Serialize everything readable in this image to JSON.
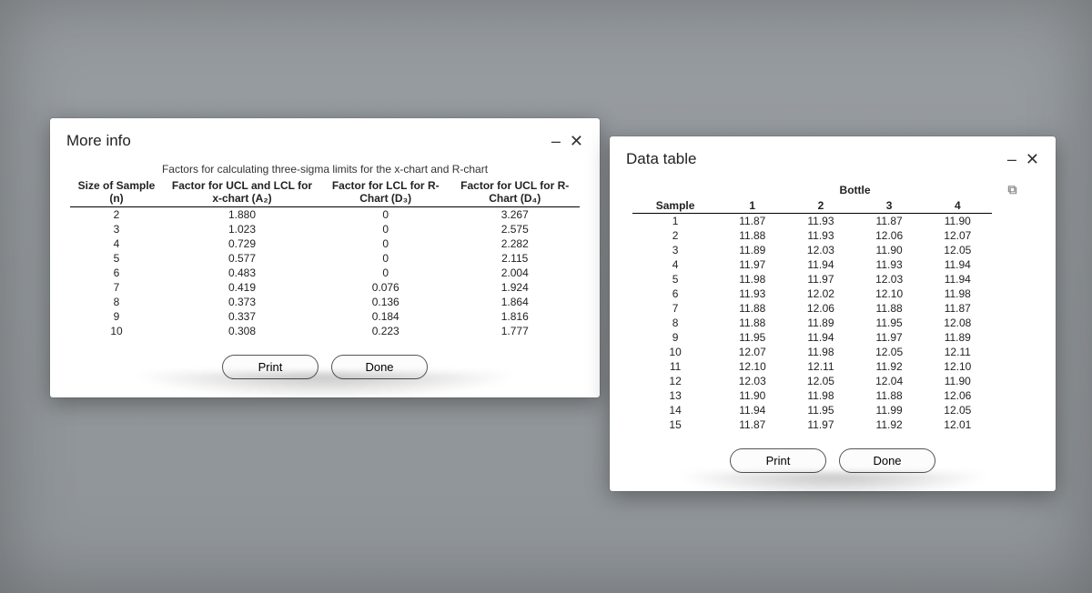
{
  "modal1": {
    "title": "More info",
    "caption": "Factors for calculating three-sigma limits for the x-chart and R-chart",
    "headers": {
      "n": "Size of Sample (n)",
      "a2": "Factor for UCL and LCL for x-chart (A₂)",
      "d3": "Factor for LCL for R-Chart (D₃)",
      "d4": "Factor for UCL for R-Chart (D₄)"
    },
    "rows": [
      {
        "n": "2",
        "a2": "1.880",
        "d3": "0",
        "d4": "3.267"
      },
      {
        "n": "3",
        "a2": "1.023",
        "d3": "0",
        "d4": "2.575"
      },
      {
        "n": "4",
        "a2": "0.729",
        "d3": "0",
        "d4": "2.282"
      },
      {
        "n": "5",
        "a2": "0.577",
        "d3": "0",
        "d4": "2.115"
      },
      {
        "n": "6",
        "a2": "0.483",
        "d3": "0",
        "d4": "2.004"
      },
      {
        "n": "7",
        "a2": "0.419",
        "d3": "0.076",
        "d4": "1.924"
      },
      {
        "n": "8",
        "a2": "0.373",
        "d3": "0.136",
        "d4": "1.864"
      },
      {
        "n": "9",
        "a2": "0.337",
        "d3": "0.184",
        "d4": "1.816"
      },
      {
        "n": "10",
        "a2": "0.308",
        "d3": "0.223",
        "d4": "1.777"
      }
    ],
    "buttons": {
      "print": "Print",
      "done": "Done"
    }
  },
  "modal2": {
    "title": "Data table",
    "group_header": "Bottle",
    "headers": {
      "sample": "Sample",
      "c1": "1",
      "c2": "2",
      "c3": "3",
      "c4": "4"
    },
    "copy_icon": "⧉",
    "rows": [
      {
        "s": "1",
        "b1": "11.87",
        "b2": "11.93",
        "b3": "11.87",
        "b4": "11.90"
      },
      {
        "s": "2",
        "b1": "11.88",
        "b2": "11.93",
        "b3": "12.06",
        "b4": "12.07"
      },
      {
        "s": "3",
        "b1": "11.89",
        "b2": "12.03",
        "b3": "11.90",
        "b4": "12.05"
      },
      {
        "s": "4",
        "b1": "11.97",
        "b2": "11.94",
        "b3": "11.93",
        "b4": "11.94"
      },
      {
        "s": "5",
        "b1": "11.98",
        "b2": "11.97",
        "b3": "12.03",
        "b4": "11.94"
      },
      {
        "s": "6",
        "b1": "11.93",
        "b2": "12.02",
        "b3": "12.10",
        "b4": "11.98"
      },
      {
        "s": "7",
        "b1": "11.88",
        "b2": "12.06",
        "b3": "11.88",
        "b4": "11.87"
      },
      {
        "s": "8",
        "b1": "11.88",
        "b2": "11.89",
        "b3": "11.95",
        "b4": "12.08"
      },
      {
        "s": "9",
        "b1": "11.95",
        "b2": "11.94",
        "b3": "11.97",
        "b4": "11.89"
      },
      {
        "s": "10",
        "b1": "12.07",
        "b2": "11.98",
        "b3": "12.05",
        "b4": "12.11"
      },
      {
        "s": "11",
        "b1": "12.10",
        "b2": "12.11",
        "b3": "11.92",
        "b4": "12.10"
      },
      {
        "s": "12",
        "b1": "12.03",
        "b2": "12.05",
        "b3": "12.04",
        "b4": "11.90"
      },
      {
        "s": "13",
        "b1": "11.90",
        "b2": "11.98",
        "b3": "11.88",
        "b4": "12.06"
      },
      {
        "s": "14",
        "b1": "11.94",
        "b2": "11.95",
        "b3": "11.99",
        "b4": "12.05"
      },
      {
        "s": "15",
        "b1": "11.87",
        "b2": "11.97",
        "b3": "11.92",
        "b4": "12.01"
      }
    ],
    "buttons": {
      "print": "Print",
      "done": "Done"
    }
  },
  "window_controls": {
    "minimize": "–",
    "close": "✕"
  }
}
